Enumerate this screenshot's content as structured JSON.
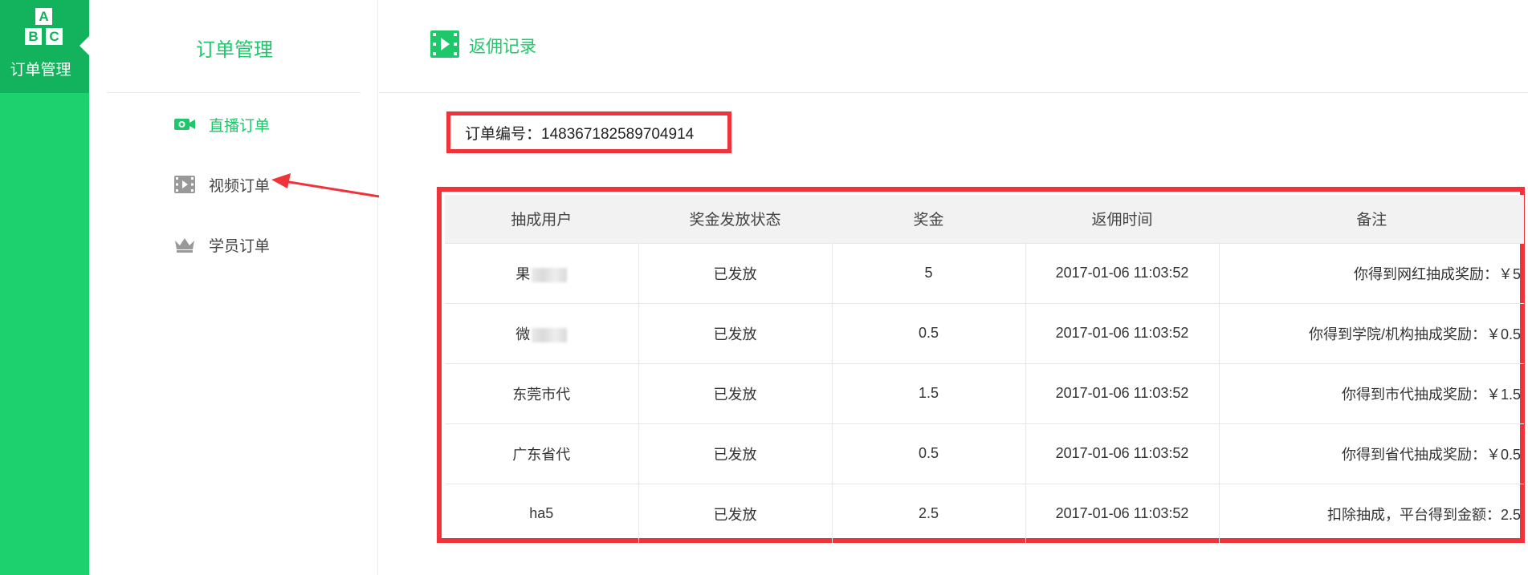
{
  "rail": {
    "logo_letters": [
      "A",
      "B",
      "C"
    ],
    "active_label": "订单管理"
  },
  "subnav": {
    "title": "订单管理",
    "items": [
      {
        "label": "直播订单",
        "icon": "live-camera-icon",
        "active": true
      },
      {
        "label": "视频订单",
        "icon": "video-film-icon",
        "active": false
      },
      {
        "label": "学员订单",
        "icon": "crown-icon",
        "active": false
      }
    ]
  },
  "header": {
    "title": "返佣记录",
    "icon": "film-play-icon"
  },
  "order": {
    "label": "订单编号：148367182589704914"
  },
  "table": {
    "columns": [
      "抽成用户",
      "奖金发放状态",
      "奖金",
      "返佣时间",
      "备注"
    ],
    "rows": [
      {
        "user": "果",
        "user_blurred": true,
        "status": "已发放",
        "bonus": "5",
        "time": "2017-01-06 11:03:52",
        "note": "你得到网红抽成奖励：￥5"
      },
      {
        "user": "微",
        "user_blurred": true,
        "status": "已发放",
        "bonus": "0.5",
        "time": "2017-01-06 11:03:52",
        "note": "你得到学院/机构抽成奖励：￥0.5"
      },
      {
        "user": "东莞市代",
        "user_blurred": false,
        "status": "已发放",
        "bonus": "1.5",
        "time": "2017-01-06 11:03:52",
        "note": "你得到市代抽成奖励：￥1.5"
      },
      {
        "user": "广东省代",
        "user_blurred": false,
        "status": "已发放",
        "bonus": "0.5",
        "time": "2017-01-06 11:03:52",
        "note": "你得到省代抽成奖励：￥0.5"
      },
      {
        "user": "ha5",
        "user_blurred": false,
        "status": "已发放",
        "bonus": "2.5",
        "time": "2017-01-06 11:03:52",
        "note": "扣除抽成，平台得到金额：2.5"
      }
    ]
  },
  "colors": {
    "brand_green": "#1ed16f",
    "brand_green_dark": "#12b35c",
    "accent_text_green": "#1ec86a",
    "highlight_red": "#f0333a"
  }
}
